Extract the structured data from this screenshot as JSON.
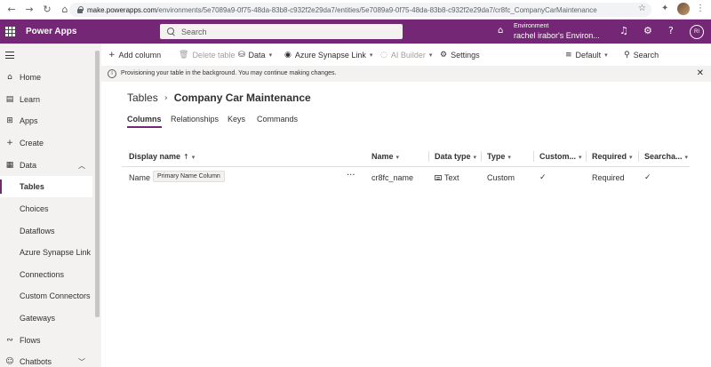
{
  "browser": {
    "url_host": "make.powerapps.com",
    "url_path": "/environments/5e7089a9-0f75-48da-83b8-c932f2e29da7/entities/5e7089a9-0f75-48da-83b8-c932f2e29da7/cr8fc_CompanyCarMaintenance"
  },
  "header": {
    "app_name": "Power Apps",
    "search_placeholder": "Search",
    "environment_label": "Environment",
    "environment_name": "rachel irabor's Environ...",
    "avatar_initials": "RI",
    "help_glyph": "?"
  },
  "sidebar": {
    "items": [
      {
        "label": "Home",
        "icon": "home-icon"
      },
      {
        "label": "Learn",
        "icon": "book-icon"
      },
      {
        "label": "Apps",
        "icon": "apps-icon"
      },
      {
        "label": "Create",
        "icon": "plus-icon"
      },
      {
        "label": "Data",
        "icon": "table-icon"
      },
      {
        "label": "Tables"
      },
      {
        "label": "Choices"
      },
      {
        "label": "Dataflows"
      },
      {
        "label": "Azure Synapse Link"
      },
      {
        "label": "Connections"
      },
      {
        "label": "Custom Connectors"
      },
      {
        "label": "Gateways"
      },
      {
        "label": "Flows",
        "icon": "flow-icon"
      },
      {
        "label": "Chatbots",
        "icon": "chatbot-icon"
      }
    ]
  },
  "commandbar": {
    "add_column": "Add column",
    "delete_table": "Delete table",
    "data": "Data",
    "azure_synapse": "Azure Synapse Link",
    "ai_builder": "AI Builder",
    "settings": "Settings",
    "view": "Default",
    "search": "Search"
  },
  "notification": {
    "message": "Provisioning your table in the background. You may continue making changes."
  },
  "breadcrumb": {
    "root": "Tables",
    "current": "Company Car Maintenance"
  },
  "tabs": [
    "Columns",
    "Relationships",
    "Keys",
    "Commands"
  ],
  "grid": {
    "columns": [
      "Display name",
      "Name",
      "Data type",
      "Type",
      "Custom...",
      "Required",
      "Searcha..."
    ],
    "rows": [
      {
        "display_name": "Name",
        "badge": "Primary Name Column",
        "name": "cr8fc_name",
        "data_type": "Text",
        "type": "Custom",
        "custom": "✓",
        "required": "Required",
        "searchable": "✓"
      }
    ]
  },
  "colors": {
    "brand": "#742774",
    "sidebar_bg": "#f3f2f1"
  }
}
